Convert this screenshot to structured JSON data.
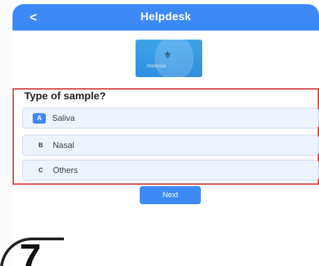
{
  "header": {
    "title": "Helpdesk",
    "back_icon": "<"
  },
  "logo": {
    "text": "Malaysia"
  },
  "question": {
    "label": "Type of sample?",
    "options": [
      {
        "key": "A",
        "label": "Saliva",
        "selected": true
      },
      {
        "key": "B",
        "label": "Nasal",
        "selected": false
      },
      {
        "key": "C",
        "label": "Others",
        "selected": false
      }
    ]
  },
  "buttons": {
    "next": "Next"
  },
  "step": {
    "number": "7"
  },
  "colors": {
    "primary": "#3d8af7",
    "highlight": "#d64545",
    "option_bg": "#eef4ff"
  }
}
